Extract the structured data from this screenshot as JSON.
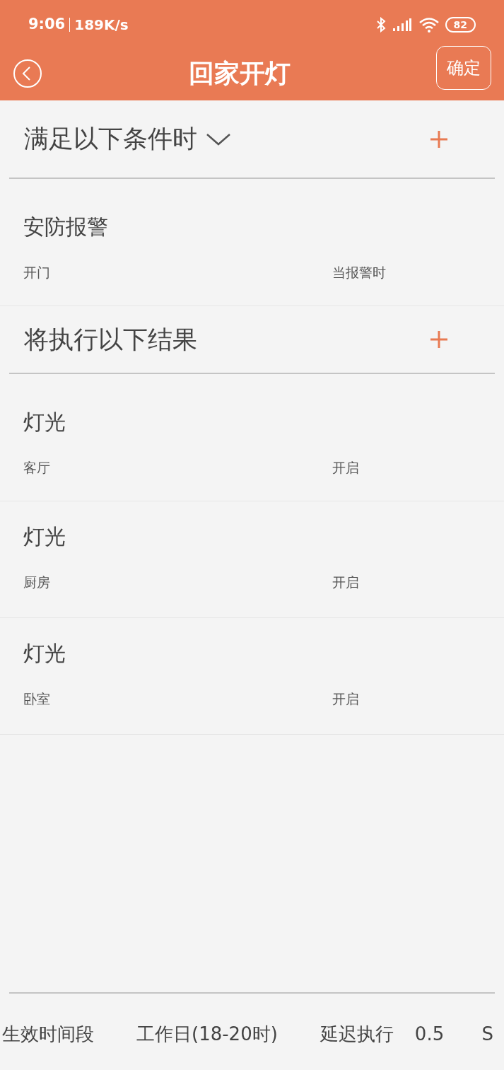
{
  "status_bar": {
    "time": "9:06",
    "speed": "189K/s",
    "battery": "82"
  },
  "header": {
    "title": "回家开灯",
    "confirm": "确定"
  },
  "conditions": {
    "title": "满足以下条件时",
    "expandable": true,
    "items": [
      {
        "name": "安防报警",
        "device": "开门",
        "action": "当报警时"
      }
    ]
  },
  "results": {
    "title": "将执行以下结果",
    "expandable": false,
    "items": [
      {
        "name": "灯光",
        "device": "客厅",
        "action": "开启"
      },
      {
        "name": "灯光",
        "device": "厨房",
        "action": "开启"
      },
      {
        "name": "灯光",
        "device": "卧室",
        "action": "开启"
      }
    ]
  },
  "footer": {
    "period_label": "生效时间段",
    "period_value": "工作日(18-20时)",
    "delay_label": "延迟执行",
    "delay_value": "0.5",
    "delay_unit": "S"
  }
}
